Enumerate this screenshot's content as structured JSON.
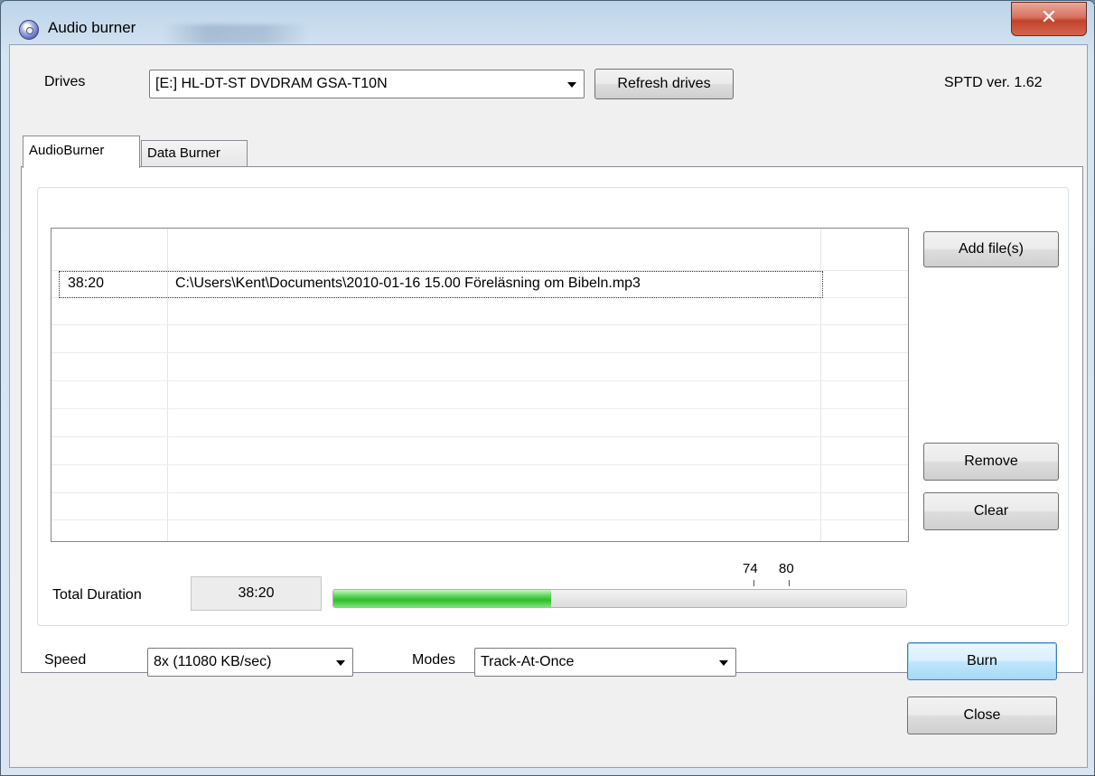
{
  "window": {
    "title": "Audio burner"
  },
  "drives": {
    "label": "Drives",
    "selected": "[E:] HL-DT-ST DVDRAM GSA-T10N",
    "refresh_label": "Refresh drives",
    "sptd_version": "SPTD ver. 1.62"
  },
  "tabs": [
    {
      "label": "AudioBurner",
      "active": true
    },
    {
      "label": "Data Burner",
      "active": false
    }
  ],
  "file_list": {
    "rows": [
      {
        "duration": "38:20",
        "path": "C:\\Users\\Kent\\Documents\\2010-01-16 15.00 Föreläsning om Bibeln.mp3"
      }
    ]
  },
  "buttons": {
    "add_files": "Add file(s)",
    "remove": "Remove",
    "clear": "Clear",
    "burn": "Burn",
    "close": "Close"
  },
  "duration": {
    "label": "Total Duration",
    "value": "38:20",
    "capacity_fraction": 0.38,
    "marker_74": "74",
    "marker_80": "80"
  },
  "speed": {
    "label": "Speed",
    "selected": "8x (11080 KB/sec)"
  },
  "modes": {
    "label": "Modes",
    "selected": "Track-At-Once"
  },
  "icons": {
    "app": "cd-audio-icon",
    "close": "close-icon",
    "dropdown": "chevron-down-icon"
  }
}
